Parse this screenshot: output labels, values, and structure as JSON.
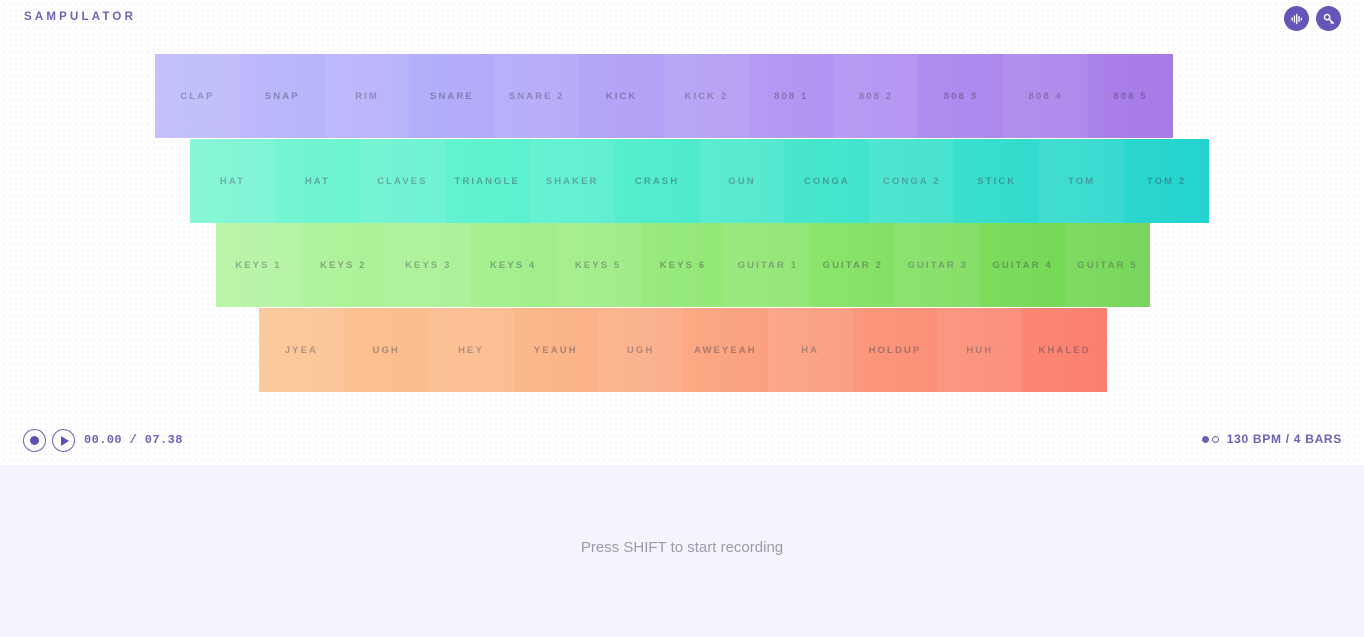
{
  "header": {
    "brand": "SAMPULATOR",
    "buttons": [
      {
        "name": "waveform-button",
        "icon": "waveform-icon",
        "label": ""
      },
      {
        "name": "key-button",
        "icon": "key-icon",
        "label": ""
      }
    ]
  },
  "colors": {
    "brand_purple": "#6b64b5",
    "button_purple": "#6456b8",
    "row1_start": "#c0bdfb",
    "row1_end": "#a87ae8",
    "row2_start": "#7ff6d4",
    "row2_end": "#23d3ce",
    "row3_start": "#b6f5a4",
    "row3_end": "#6ed34f",
    "row4_start": "#fbc694",
    "row4_end": "#fb7f6f",
    "lower_bg": "#f4f4fc",
    "hint_text": "#9a9aab"
  },
  "pad_rows": [
    {
      "name": "drums-row",
      "pads": [
        {
          "label": "CLAP"
        },
        {
          "label": "SNAP"
        },
        {
          "label": "RIM"
        },
        {
          "label": "SNARE"
        },
        {
          "label": "SNARE 2"
        },
        {
          "label": "KICK"
        },
        {
          "label": "KICK 2"
        },
        {
          "label": "808 1"
        },
        {
          "label": "808 2"
        },
        {
          "label": "808 3"
        },
        {
          "label": "808 4"
        },
        {
          "label": "808 5"
        }
      ]
    },
    {
      "name": "percussion-row",
      "pads": [
        {
          "label": "HAT"
        },
        {
          "label": "HAT"
        },
        {
          "label": "CLAVES"
        },
        {
          "label": "TRIANGLE"
        },
        {
          "label": "SHAKER"
        },
        {
          "label": "CRASH"
        },
        {
          "label": "GUN"
        },
        {
          "label": "CONGA"
        },
        {
          "label": "CONGA 2"
        },
        {
          "label": "STICK"
        },
        {
          "label": "TOM"
        },
        {
          "label": "TOM 2"
        }
      ]
    },
    {
      "name": "melodic-row",
      "pads": [
        {
          "label": "KEYS 1"
        },
        {
          "label": "KEYS 2"
        },
        {
          "label": "KEYS 3"
        },
        {
          "label": "KEYS 4"
        },
        {
          "label": "KEYS 5"
        },
        {
          "label": "KEYS 6"
        },
        {
          "label": "GUITAR 1"
        },
        {
          "label": "GUITAR 2"
        },
        {
          "label": "GUITAR 3"
        },
        {
          "label": "GUITAR 4"
        },
        {
          "label": "GUITAR 5"
        }
      ]
    },
    {
      "name": "vocal-row",
      "pads": [
        {
          "label": "JYEA"
        },
        {
          "label": "UGH"
        },
        {
          "label": "HEY"
        },
        {
          "label": "YEAUH"
        },
        {
          "label": "UGH"
        },
        {
          "label": "AWEYEAH"
        },
        {
          "label": "HA"
        },
        {
          "label": "HOLDUP"
        },
        {
          "label": "HUH"
        },
        {
          "label": "KHALED"
        }
      ]
    }
  ],
  "transport": {
    "record_icon": "record-icon",
    "play_icon": "play-icon",
    "time_display": "00.00 / 07.38",
    "tempo_text": "130 BPM / 4 BARS"
  },
  "lower": {
    "hint": "Press SHIFT to start recording"
  }
}
